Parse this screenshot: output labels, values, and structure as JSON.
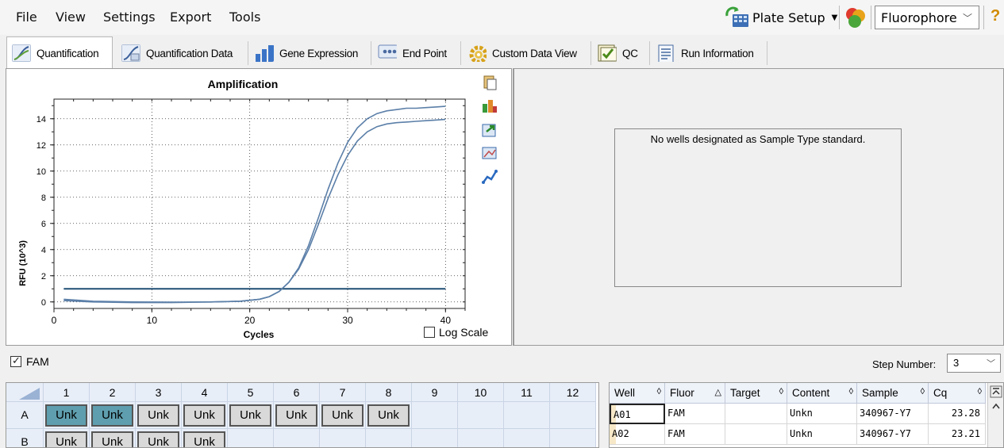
{
  "menu": {
    "file": "File",
    "view": "View",
    "settings": "Settings",
    "export": "Export",
    "tools": "Tools",
    "plate_setup": "Plate Setup",
    "fluorophore": "Fluorophore",
    "help": "?"
  },
  "tabs": [
    {
      "label": "Quantification",
      "icon": "amplification-icon",
      "color": "#4a72a8"
    },
    {
      "label": "Quantification Data",
      "icon": "quant-data-icon",
      "color": "#4a72a8"
    },
    {
      "label": "Gene Expression",
      "icon": "bar-chart-icon",
      "color": "#3b74c7"
    },
    {
      "label": "End Point",
      "icon": "end-point-icon",
      "color": "#6b86b8"
    },
    {
      "label": "Custom Data View",
      "icon": "gear-icon",
      "color": "#d7a21a"
    },
    {
      "label": "QC",
      "icon": "check-icon",
      "color": "#6a9a2a"
    },
    {
      "label": "Run Information",
      "icon": "document-icon",
      "color": "#456aa0"
    }
  ],
  "chart_data": {
    "type": "line",
    "title": "Amplification",
    "xlabel": "Cycles",
    "ylabel": "RFU (10^3)",
    "xlim": [
      0,
      42
    ],
    "ylim": [
      -0.5,
      15.5
    ],
    "xticks": [
      0,
      10,
      20,
      30,
      40
    ],
    "yticks": [
      0,
      2,
      4,
      6,
      8,
      10,
      12,
      14
    ],
    "grid": "dotted",
    "threshold": 1.0,
    "series": [
      {
        "color": "#5b7fa8",
        "x": [
          1,
          4,
          8,
          12,
          16,
          19,
          21,
          22,
          23,
          24,
          25,
          26,
          27,
          28,
          29,
          30,
          31,
          32,
          33,
          34,
          35,
          36,
          37,
          38,
          39,
          40
        ],
        "values": [
          0.2,
          0.05,
          0.0,
          -0.02,
          0.0,
          0.05,
          0.2,
          0.4,
          0.8,
          1.5,
          2.6,
          4.3,
          6.4,
          8.6,
          10.6,
          12.2,
          13.3,
          14.0,
          14.4,
          14.6,
          14.7,
          14.8,
          14.8,
          14.85,
          14.9,
          14.95
        ]
      },
      {
        "color": "#5b7fa8",
        "x": [
          1,
          4,
          8,
          12,
          16,
          19,
          21,
          22,
          23,
          24,
          25,
          26,
          27,
          28,
          29,
          30,
          31,
          32,
          33,
          34,
          35,
          36,
          37,
          38,
          39,
          40
        ],
        "values": [
          0.1,
          0.0,
          -0.05,
          -0.05,
          0.0,
          0.05,
          0.2,
          0.4,
          0.8,
          1.5,
          2.5,
          4.0,
          5.9,
          7.9,
          9.7,
          11.2,
          12.3,
          13.0,
          13.4,
          13.6,
          13.7,
          13.75,
          13.8,
          13.85,
          13.9,
          13.95
        ]
      }
    ]
  },
  "chart": {
    "log_scale": "Log Scale"
  },
  "standards": {
    "message": "No wells designated as Sample Type standard."
  },
  "fam": {
    "label": "FAM",
    "step_label": "Step Number:",
    "step_value": "3"
  },
  "plate": {
    "columns": [
      "1",
      "2",
      "3",
      "4",
      "5",
      "6",
      "7",
      "8",
      "9",
      "10",
      "11",
      "12"
    ],
    "rows": [
      "A",
      "B"
    ],
    "row_a": [
      "Unk",
      "Unk",
      "Unk",
      "Unk",
      "Unk",
      "Unk",
      "Unk",
      "Unk"
    ],
    "row_b": [
      "Unk",
      "Unk",
      "Unk",
      "Unk"
    ]
  },
  "results": {
    "headers": [
      "Well",
      "Fluor",
      "Target",
      "Content",
      "Sample",
      "Cq"
    ],
    "rows": [
      [
        "A01",
        "FAM",
        "",
        "Unkn",
        "340967-Y7",
        "23.28"
      ],
      [
        "A02",
        "FAM",
        "",
        "Unkn",
        "340967-Y7",
        "23.21"
      ]
    ]
  }
}
